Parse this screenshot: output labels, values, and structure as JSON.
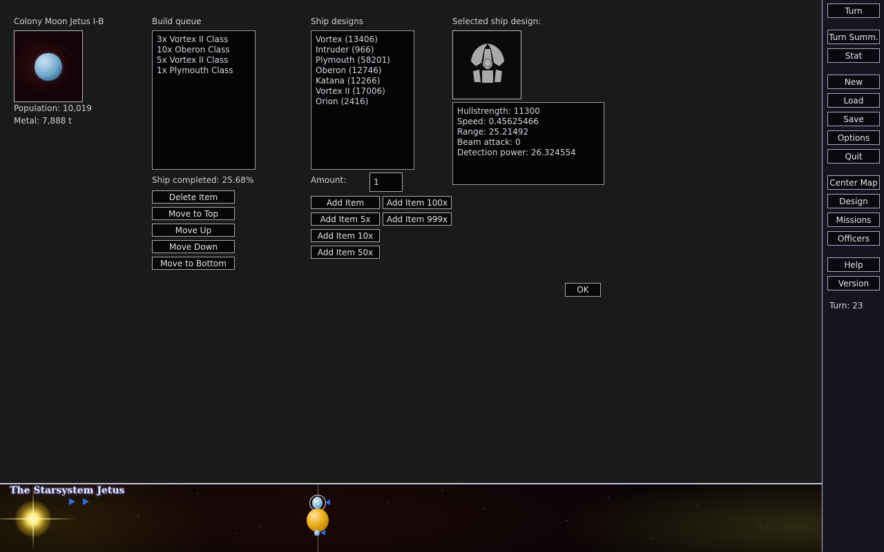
{
  "colony": {
    "title": "Colony Moon Jetus I-B",
    "thumbnail_icon": "planet-thumbnail",
    "population_label": "Population: 10,019",
    "metal_label": "Metal: 7,888 t"
  },
  "build_queue": {
    "label": "Build queue",
    "items": [
      "3x Vortex II Class",
      "10x Oberon Class",
      "5x Vortex II Class",
      "1x Plymouth Class"
    ],
    "progress_label": "Ship completed: 25.68%",
    "buttons": [
      "Delete Item",
      "Move to Top",
      "Move Up",
      "Move Down",
      "Move to Bottom"
    ]
  },
  "ship_designs": {
    "label": "Ship designs",
    "items": [
      "Vortex (13406)",
      "Intruder (966)",
      "Plymouth (58201)",
      "Oberon (12746)",
      "Katana (12266)",
      "Vortex II (17006)",
      "Orion (2416)"
    ],
    "amount_label": "Amount:",
    "amount_value": "1",
    "add_buttons_col1": [
      "Add Item",
      "Add Item 5x",
      "Add Item 10x",
      "Add Item 50x"
    ],
    "add_buttons_col2": [
      "Add Item 100x",
      "Add Item 999x"
    ]
  },
  "selected_design": {
    "label": "Selected ship design:",
    "icon": "spaceship-icon",
    "stats": [
      "Hullstrength: 11300",
      "Speed: 0.45625466",
      "Range: 25.21492",
      "Beam attack: 0",
      "Detection power: 26.324554"
    ]
  },
  "dialog": {
    "ok_label": "OK"
  },
  "sidebar": {
    "groups": [
      {
        "buttons": [
          "Turn"
        ]
      },
      {
        "buttons": [
          "Turn Summ.",
          "Stat"
        ]
      },
      {
        "buttons": [
          "New",
          "Load",
          "Save",
          "Options",
          "Quit"
        ]
      },
      {
        "buttons": [
          "Center Map",
          "Design",
          "Missions",
          "Officers"
        ]
      },
      {
        "buttons": [
          "Help",
          "Version"
        ]
      }
    ],
    "turn_label": "Turn:  23"
  },
  "starsystem": {
    "title": "The Starsystem Jetus",
    "star_icon": "star-sun",
    "bodies": [
      {
        "name": "blue-moon-selected",
        "color": "#9cc4e0"
      },
      {
        "name": "orange-planet",
        "color": "#e2a81c"
      },
      {
        "name": "blue-moon-lower",
        "color": "#7fb2d8"
      },
      {
        "name": "grey-planet-upper",
        "color": "#d5d5cf"
      },
      {
        "name": "grey-planet-lower",
        "color": "#d5d5cf"
      }
    ]
  },
  "colors": {
    "background": "#1a1a1a",
    "listbox_bg": "#050507",
    "border": "#a8a8b2",
    "sidebar_bg": "#13131f",
    "text": "#d6d6dc",
    "accent_blue": "#2b6fe0",
    "sun_yellow": "#ffe873"
  }
}
